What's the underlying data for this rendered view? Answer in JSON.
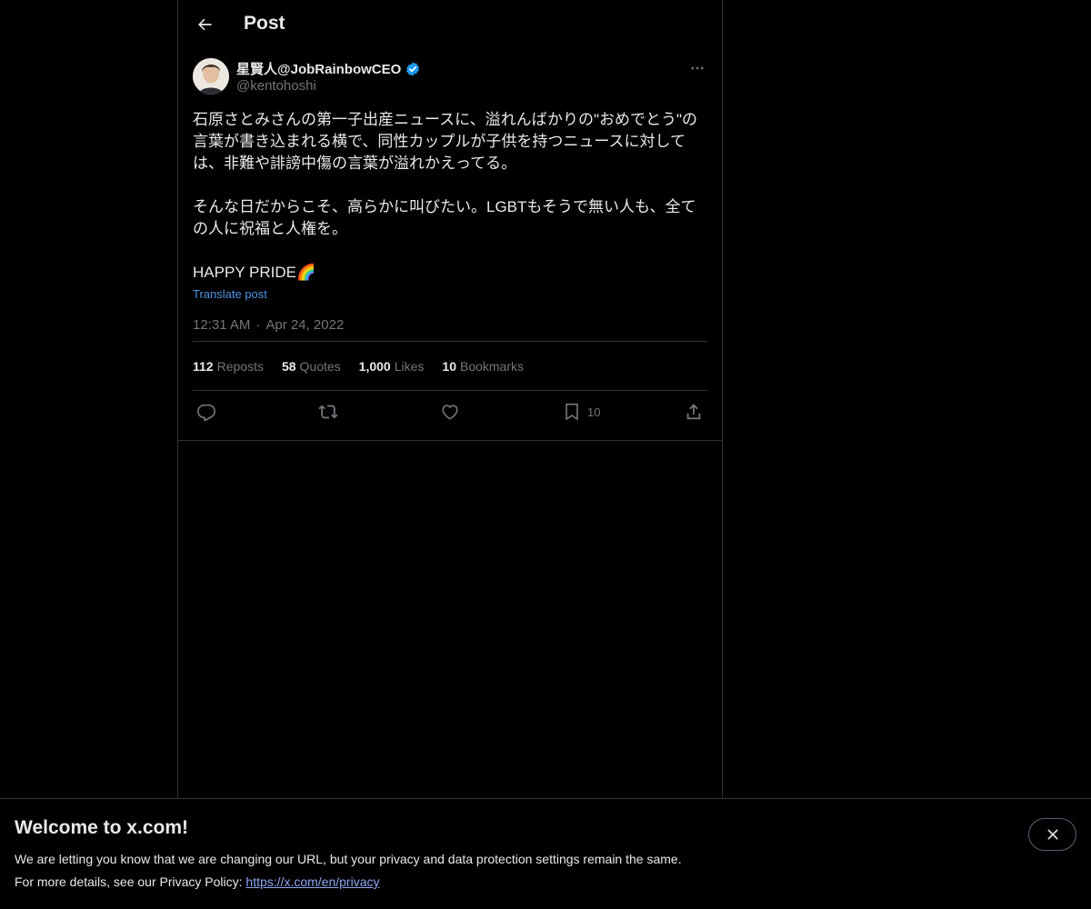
{
  "header": {
    "title": "Post"
  },
  "post": {
    "author": {
      "name": "星賢人@JobRainbowCEO",
      "handle": "@kentohoshi",
      "verified": true
    },
    "text": "石原さとみさんの第一子出産ニュースに、溢れんばかりの\"おめでとう\"の言葉が書き込まれる横で、同性カップルが子供を持つニュースに対しては、非難や誹謗中傷の言葉が溢れかえってる。\n\nそんな日だからこそ、高らかに叫びたい。LGBTもそうで無い人も、全ての人に祝福と人権を。\n\nHAPPY PRIDE🌈",
    "translate_label": "Translate post",
    "time": "12:31 AM",
    "date": "Apr 24, 2022",
    "meta_separator": "·",
    "stats": {
      "reposts_count": "112",
      "reposts_label": "Reposts",
      "quotes_count": "58",
      "quotes_label": "Quotes",
      "likes_count": "1,000",
      "likes_label": "Likes",
      "bookmarks_count": "10",
      "bookmarks_label": "Bookmarks"
    },
    "actions": {
      "bookmark_count": "10"
    }
  },
  "banner": {
    "title": "Welcome to x.com!",
    "line1": "We are letting you know that we are changing our URL, but your privacy and data protection settings remain the same.",
    "line2_prefix": "For more details, see our Privacy Policy: ",
    "privacy_link": "https://x.com/en/privacy"
  },
  "colors": {
    "background": "#000000",
    "text": "#e7e9ea",
    "muted": "#71767b",
    "accent_link": "#4d93e6",
    "verified_badge": "#1d9bf0",
    "border": "#2f3336"
  },
  "icons": {
    "back": "arrow-left-icon",
    "more": "more-horizontal-icon",
    "verified": "verified-badge-icon",
    "reply": "reply-icon",
    "repost": "repost-icon",
    "like": "heart-icon",
    "bookmark": "bookmark-icon",
    "share": "share-icon",
    "close": "close-icon"
  }
}
